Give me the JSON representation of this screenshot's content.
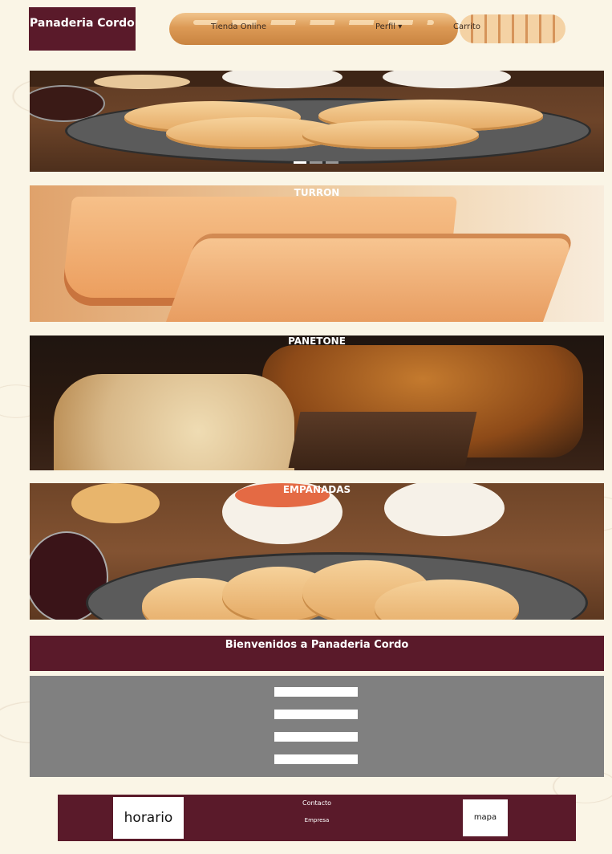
{
  "brand": {
    "name": "Panaderia Cordo"
  },
  "nav": {
    "items": [
      {
        "label": "Tienda Online"
      },
      {
        "label": "Perfil ▾"
      },
      {
        "label": "Carrito"
      }
    ]
  },
  "banners": [
    {
      "title": "",
      "subtitle": ""
    },
    {
      "title": "TURRON",
      "subtitle": ""
    },
    {
      "title": "PANETONE",
      "subtitle": ""
    },
    {
      "title": "EMPANADAS",
      "subtitle": ""
    }
  ],
  "welcome": {
    "title": "Bienvenidos a Panaderia Cordo",
    "text": ""
  },
  "form": {
    "fields": [
      {
        "label": ""
      },
      {
        "label": ""
      },
      {
        "label": ""
      },
      {
        "label": ""
      }
    ],
    "submit_label": ""
  },
  "footer": {
    "horario_label": "horario",
    "contacto_label": "Contacto",
    "empresa_label": "Empresa",
    "mapa_label": "mapa"
  },
  "colors": {
    "brand": "#5a1a2a",
    "form_bg": "#808080",
    "page_bg": "#faf5e6"
  }
}
